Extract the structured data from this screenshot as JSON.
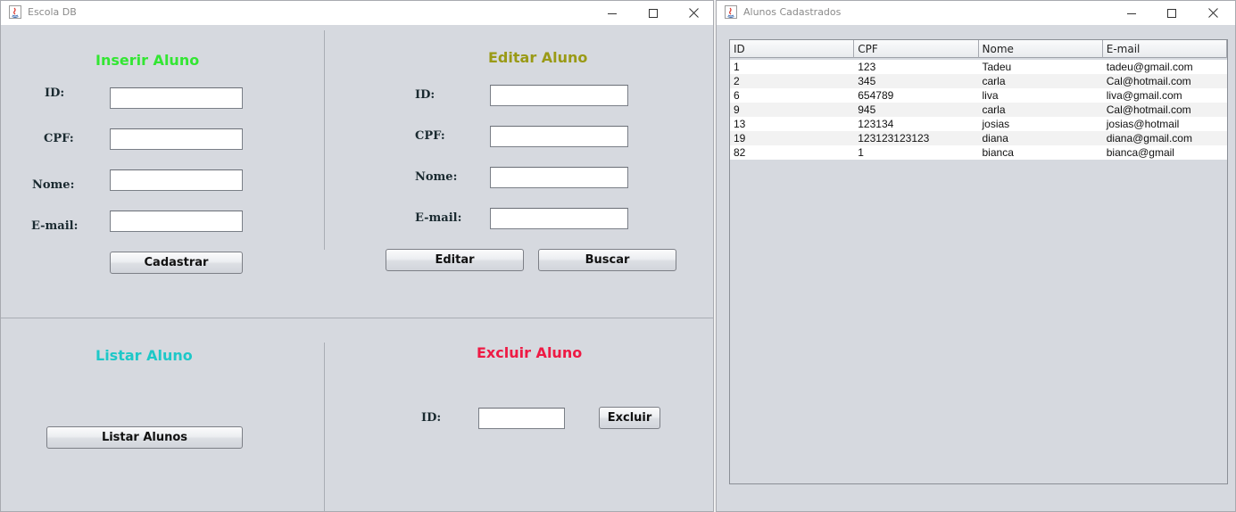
{
  "escola": {
    "title": "Escola DB",
    "inserir": {
      "title": "Inserir Aluno",
      "color": "#33e633",
      "id_label": "ID:",
      "cpf_label": "CPF:",
      "nome_label": "Nome:",
      "email_label": "E-mail:",
      "submit": "Cadastrar"
    },
    "editar": {
      "title": "Editar Aluno",
      "color": "#9a9a16",
      "id_label": "ID:",
      "cpf_label": "CPF:",
      "nome_label": "Nome:",
      "email_label": "E-mail:",
      "edit_button": "Editar",
      "search_button": "Buscar"
    },
    "listar": {
      "title": "Listar Aluno",
      "color": "#1ec8c8",
      "button": "Listar Alunos"
    },
    "excluir": {
      "title": "Excluir Aluno",
      "color": "#ee1a44",
      "id_label": "ID:",
      "button": "Excluir"
    }
  },
  "alunos": {
    "title": "Alunos Cadastrados",
    "columns": [
      "ID",
      "CPF",
      "Nome",
      "E-mail"
    ],
    "rows": [
      [
        "1",
        "123",
        "Tadeu",
        "tadeu@gmail.com"
      ],
      [
        "2",
        "345",
        "carla",
        "Cal@hotmail.com"
      ],
      [
        "6",
        "654789",
        "liva",
        "liva@gmail.com"
      ],
      [
        "9",
        "945",
        "carla",
        "Cal@hotmail.com"
      ],
      [
        "13",
        "123134",
        "josias",
        "josias@hotmail"
      ],
      [
        "19",
        "123123123123",
        "diana",
        "diana@gmail.com"
      ],
      [
        "82",
        "1",
        "bianca",
        "bianca@gmail"
      ]
    ]
  }
}
